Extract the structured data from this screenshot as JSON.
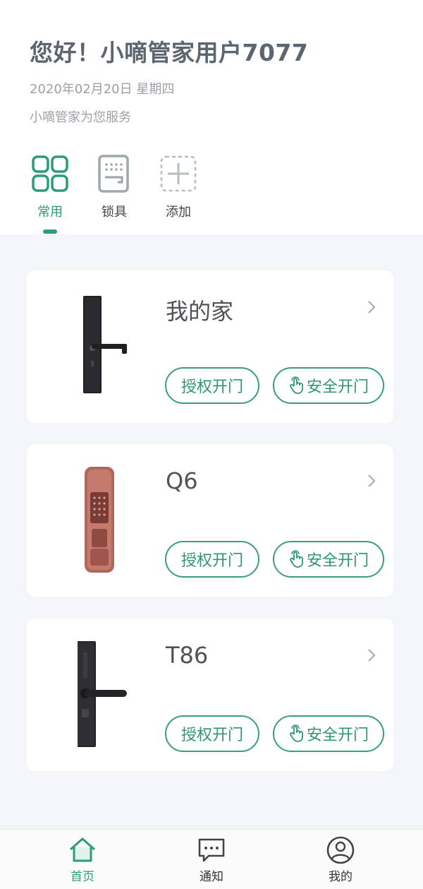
{
  "header": {
    "greeting": "您好！小嘀管家用户7077",
    "date": "2020年02月20日 星期四",
    "subtitle": "小嘀管家为您服务"
  },
  "tabs": [
    {
      "label": "常用",
      "icon": "grid-icon",
      "active": true
    },
    {
      "label": "锁具",
      "icon": "keypad-icon",
      "active": false
    },
    {
      "label": "添加",
      "icon": "add-icon",
      "active": false
    }
  ],
  "locks": [
    {
      "name": "我的家",
      "auth_label": "授权开门",
      "safe_label": "安全开门",
      "color": "#1e1f21"
    },
    {
      "name": "Q6",
      "auth_label": "授权开门",
      "safe_label": "安全开门",
      "color": "#b0675d"
    },
    {
      "name": "T86",
      "auth_label": "授权开门",
      "safe_label": "安全开门",
      "color": "#232427"
    }
  ],
  "bottom_nav": [
    {
      "label": "首页",
      "icon": "home-icon",
      "active": true
    },
    {
      "label": "通知",
      "icon": "message-icon",
      "active": false
    },
    {
      "label": "我的",
      "icon": "user-icon",
      "active": false
    }
  ],
  "colors": {
    "accent": "#2d9b7a",
    "background": "#f3f5f8"
  }
}
